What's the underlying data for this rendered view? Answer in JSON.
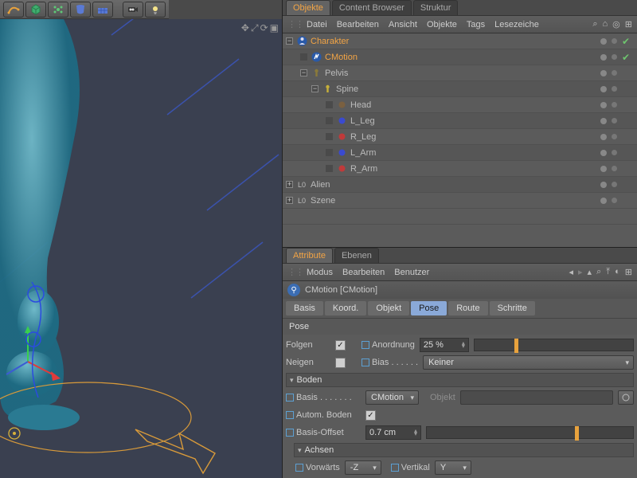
{
  "top_tabs": {
    "objekte": "Objekte",
    "content": "Content Browser",
    "struktur": "Struktur"
  },
  "obj_menu": {
    "datei": "Datei",
    "bearbeiten": "Bearbeiten",
    "ansicht": "Ansicht",
    "objekte": "Objekte",
    "tags": "Tags",
    "lesez": "Lesezeiche"
  },
  "tree": {
    "charakter": "Charakter",
    "cmotion": "CMotion",
    "pelvis": "Pelvis",
    "spine": "Spine",
    "head": "Head",
    "lleg": "L_Leg",
    "rleg": "R_Leg",
    "larm": "L_Arm",
    "rarm": "R_Arm",
    "alien": "Alien",
    "szene": "Szene"
  },
  "attr_tabs": {
    "attribute": "Attribute",
    "ebenen": "Ebenen"
  },
  "attr_menu": {
    "modus": "Modus",
    "bearbeiten": "Bearbeiten",
    "benutzer": "Benutzer"
  },
  "obj_title": "CMotion [CMotion]",
  "subtabs": {
    "basis": "Basis",
    "koord": "Koord.",
    "objekt": "Objekt",
    "pose": "Pose",
    "route": "Route",
    "schritte": "Schritte"
  },
  "pose": {
    "title": "Pose",
    "folgen": "Folgen",
    "anordnung": "Anordnung",
    "anordnung_val": "25 %",
    "neigen": "Neigen",
    "bias": "Bias . . . . . .",
    "bias_val": "Keiner",
    "boden_hdr": "Boden",
    "basis": "Basis . . . . . . .",
    "basis_val": "CMotion",
    "objekt_lbl": "Objekt",
    "autom": "Autom. Boden",
    "offset": "Basis-Offset",
    "offset_val": "0.7 cm",
    "achsen_hdr": "Achsen",
    "vorwarts": "Vorwärts",
    "vorwarts_val": "-Z",
    "vertikal": "Vertikal",
    "vertikal_val": "Y"
  }
}
